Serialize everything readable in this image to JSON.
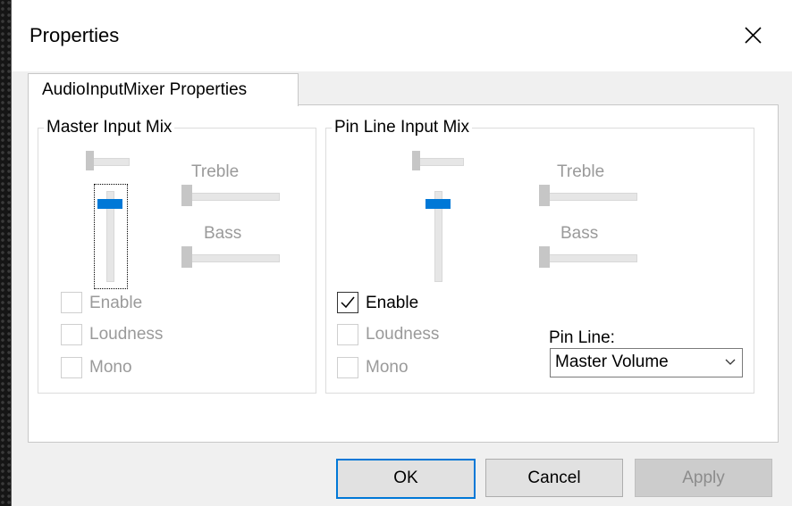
{
  "dialog": {
    "title": "Properties"
  },
  "tabs": [
    {
      "label": "AudioInputMixer Properties",
      "selected": true
    }
  ],
  "master": {
    "group_title": "Master Input Mix",
    "treble_label": "Treble",
    "bass_label": "Bass",
    "checkboxes": [
      {
        "label": "Enable",
        "checked": false,
        "enabled": false
      },
      {
        "label": "Loudness",
        "checked": false,
        "enabled": false
      },
      {
        "label": "Mono",
        "checked": false,
        "enabled": false
      }
    ]
  },
  "pin": {
    "group_title": "Pin Line Input Mix",
    "treble_label": "Treble",
    "bass_label": "Bass",
    "checkboxes": [
      {
        "label": "Enable",
        "checked": true,
        "enabled": true
      },
      {
        "label": "Loudness",
        "checked": false,
        "enabled": false
      },
      {
        "label": "Mono",
        "checked": false,
        "enabled": false
      }
    ],
    "pin_line_label": "Pin Line:",
    "pin_line_value": "Master Volume"
  },
  "buttons": {
    "ok": "OK",
    "cancel": "Cancel",
    "apply": "Apply"
  },
  "colors": {
    "accent": "#0078d7",
    "disabled_text": "#9a9a9a"
  }
}
